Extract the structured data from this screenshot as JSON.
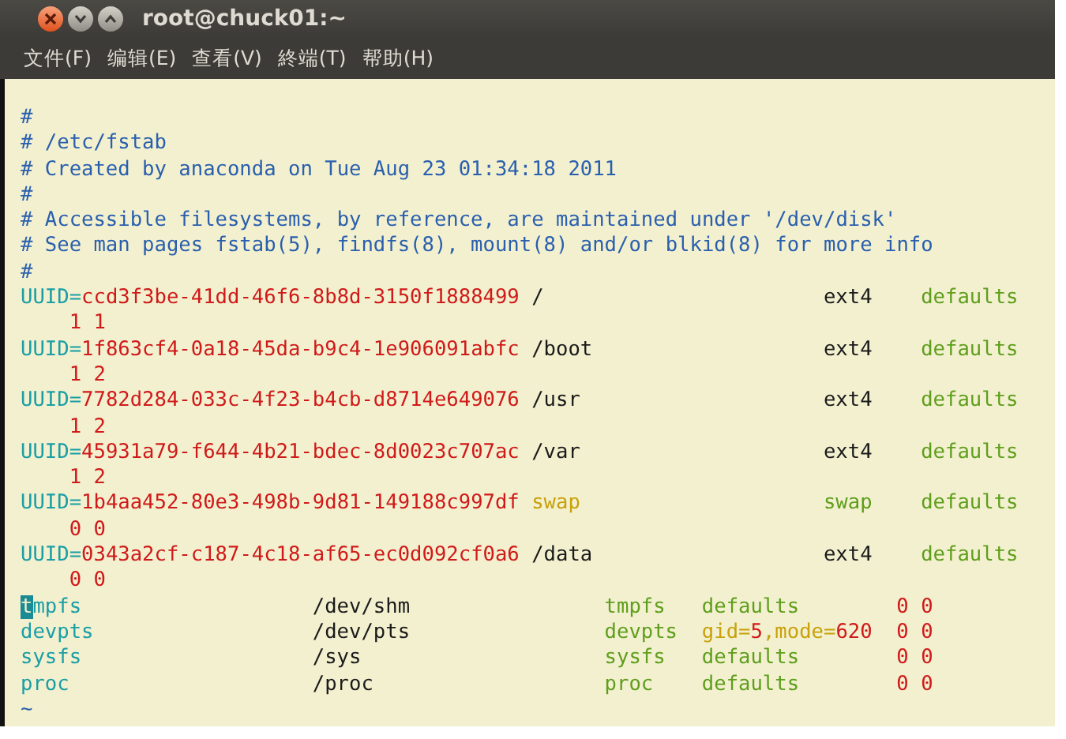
{
  "window": {
    "title": "root@chuck01:~"
  },
  "menu": [
    "文件(F)",
    "编辑(E)",
    "查看(V)",
    "終端(T)",
    "帮助(H)"
  ],
  "comment_lines": [
    "#",
    "# /etc/fstab",
    "# Created by anaconda on Tue Aug 23 01:34:18 2011",
    "#",
    "# Accessible filesystems, by reference, are maintained under '/dev/disk'",
    "# See man pages fstab(5), findfs(8), mount(8) and/or blkid(8) for more info",
    "#"
  ],
  "uuid_entries": [
    {
      "key": "UUID=",
      "uuid": "ccd3f3be-41dd-46f6-8b8d-3150f1888499",
      "mount": "/",
      "fstype": "ext4",
      "kind": "fs",
      "options": "defaults",
      "dump_pass": "1 1"
    },
    {
      "key": "UUID=",
      "uuid": "1f863cf4-0a18-45da-b9c4-1e906091abfc",
      "mount": "/boot",
      "fstype": "ext4",
      "kind": "fs",
      "options": "defaults",
      "dump_pass": "1 2"
    },
    {
      "key": "UUID=",
      "uuid": "7782d284-033c-4f23-b4cb-d8714e649076",
      "mount": "/usr",
      "fstype": "ext4",
      "kind": "fs",
      "options": "defaults",
      "dump_pass": "1 2"
    },
    {
      "key": "UUID=",
      "uuid": "45931a79-f644-4b21-bdec-8d0023c707ac",
      "mount": "/var",
      "fstype": "ext4",
      "kind": "fs",
      "options": "defaults",
      "dump_pass": "1 2"
    },
    {
      "key": "UUID=",
      "uuid": "1b4aa452-80e3-498b-9d81-149188c997df",
      "mount": "swap",
      "fstype": "swap",
      "kind": "swap",
      "options": "defaults",
      "dump_pass": "0 0"
    },
    {
      "key": "UUID=",
      "uuid": "0343a2cf-c187-4c18-af65-ec0d092cf0a6",
      "mount": "/data",
      "fstype": "ext4",
      "kind": "fs",
      "options": "defaults",
      "dump_pass": "0 0"
    }
  ],
  "other_entries": [
    {
      "device": "tmpfs",
      "cursor": true,
      "mount": "/dev/shm",
      "fstype": "tmpfs",
      "options": [
        {
          "text": "defaults",
          "kind": "plain"
        }
      ],
      "dump_pass": "0 0"
    },
    {
      "device": "devpts",
      "cursor": false,
      "mount": "/dev/pts",
      "fstype": "devpts",
      "options": [
        {
          "text": "gid=",
          "kind": "key"
        },
        {
          "text": "5",
          "kind": "number"
        },
        {
          "text": ",mode=",
          "kind": "key"
        },
        {
          "text": "620",
          "kind": "number"
        }
      ],
      "dump_pass": "0 0"
    },
    {
      "device": "sysfs",
      "cursor": false,
      "mount": "/sys",
      "fstype": "sysfs",
      "options": [
        {
          "text": "defaults",
          "kind": "plain"
        }
      ],
      "dump_pass": "0 0"
    },
    {
      "device": "proc",
      "cursor": false,
      "mount": "/proc",
      "fstype": "proc",
      "options": [
        {
          "text": "defaults",
          "kind": "plain"
        }
      ],
      "dump_pass": "0 0"
    }
  ],
  "filler_lines": [
    "~"
  ]
}
